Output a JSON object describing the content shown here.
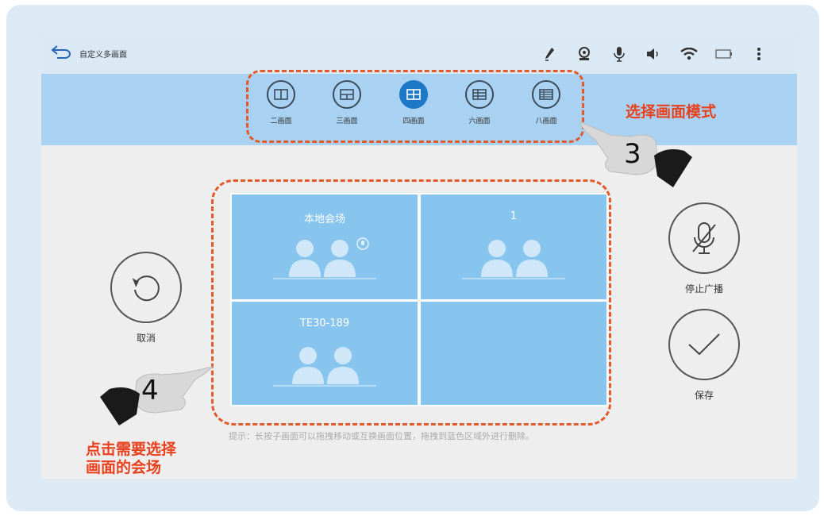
{
  "topbar": {
    "title": "自定义多画面",
    "icons": [
      "pen-icon",
      "camera-icon",
      "microphone-icon",
      "speaker-icon",
      "wifi-icon",
      "battery-icon",
      "more-menu-icon"
    ]
  },
  "modes": [
    {
      "label": "二画面",
      "icon": "layout-two-icon",
      "active": false
    },
    {
      "label": "三画面",
      "icon": "layout-three-icon",
      "active": false
    },
    {
      "label": "四画面",
      "icon": "layout-four-icon",
      "active": true
    },
    {
      "label": "六画面",
      "icon": "layout-six-icon",
      "active": false
    },
    {
      "label": "八画面",
      "icon": "layout-eight-icon",
      "active": false
    }
  ],
  "grid": {
    "cells": [
      {
        "name": "本地会场",
        "has_people": true,
        "has_mic_badge": true
      },
      {
        "name": "1",
        "has_people": true,
        "has_mic_badge": false
      },
      {
        "name": "TE30-189",
        "has_people": true,
        "has_mic_badge": false
      },
      {
        "name": "",
        "has_people": false,
        "has_mic_badge": false
      }
    ]
  },
  "left_actions": {
    "cancel_label": "取消"
  },
  "right_actions": {
    "stop_broadcast_label": "停止广播",
    "save_label": "保存"
  },
  "hint": "提示：长按子画面可以拖拽移动或互换画面位置，拖拽到蓝色区域外进行删除。",
  "annotations": {
    "select_mode": "选择画面模式",
    "click_venue_line1": "点击需要选择",
    "click_venue_line2": "画面的会场",
    "step3": "3",
    "step4": "4"
  },
  "colors": {
    "accent": "#1e78c8",
    "cell_fill": "#87c5ee",
    "mode_bar": "#a9d2f2",
    "annotation": "#e8411e"
  }
}
